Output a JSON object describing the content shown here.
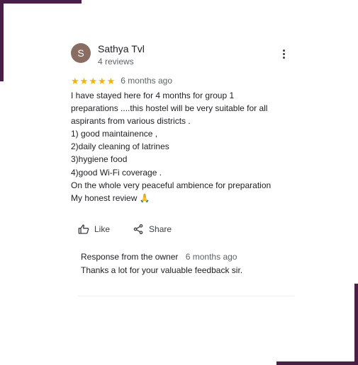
{
  "review": {
    "avatar_initial": "S",
    "reviewer_name": "Sathya Tvl",
    "review_count": "4 reviews",
    "rating": 5,
    "stars": [
      "★",
      "★",
      "★",
      "★",
      "★"
    ],
    "date": "6 months ago",
    "lines": [
      "I have stayed here for 4 months for group 1",
      "preparations ....this hostel will be very suitable for all",
      "aspirants from various districts .",
      "1) good maintainence ,",
      "2)daily cleaning of latrines",
      "3)hygiene food",
      "4)good Wi-Fi coverage .",
      "On the whole very peaceful ambience for preparation",
      "My honest review 🙏"
    ]
  },
  "actions": {
    "like_label": "Like",
    "share_label": "Share"
  },
  "owner_response": {
    "label": "Response from the owner",
    "date": "6 months ago",
    "text": "Thanks a lot for your valuable feedback sir."
  },
  "icons": {
    "more": "more-vertical-icon",
    "star": "star-icon",
    "like": "thumbs-up-icon",
    "share": "share-icon"
  },
  "colors": {
    "frame": "#4a1f45",
    "avatar": "#8a6d62",
    "star": "#f4b400",
    "primary_text": "#202124",
    "secondary_text": "#5f6368"
  }
}
